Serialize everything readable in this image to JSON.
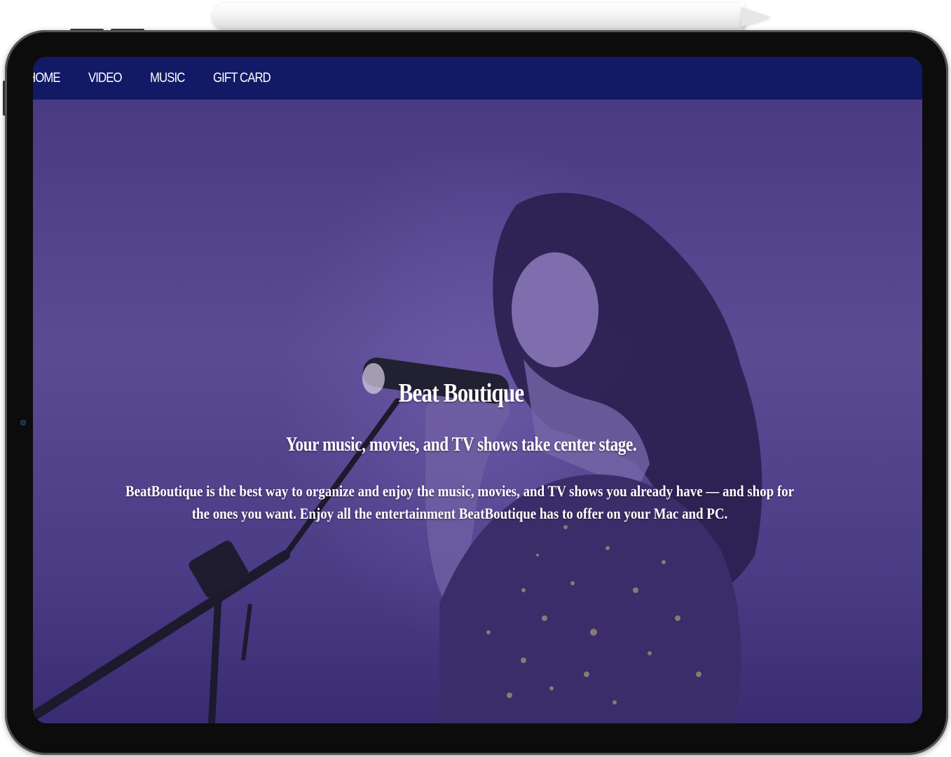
{
  "nav": {
    "items": [
      {
        "label": "HOME"
      },
      {
        "label": "VIDEO"
      },
      {
        "label": "MUSIC"
      },
      {
        "label": "GIFT CARD"
      }
    ]
  },
  "hero": {
    "title": "Beat Boutique",
    "subtitle": "Your music, movies, and TV shows take center stage.",
    "body": "BeatBoutique is the best way to organize and enjoy the music, movies, and TV shows you already have — and shop for the ones you want. Enjoy all the entertainment BeatBoutique has to offer on your Mac and PC."
  },
  "colors": {
    "navbar": "#121a66",
    "hero_tint": "#4a3a84",
    "text": "#ffffff",
    "device_frame": "#0c0c0c"
  }
}
